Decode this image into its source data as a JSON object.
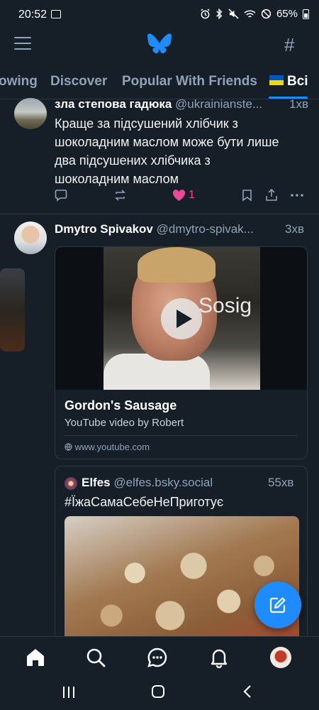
{
  "status_bar": {
    "time": "20:52",
    "battery": "65%"
  },
  "header": {
    "icons": [
      "menu-icon",
      "butterfly-logo",
      "hash-icon"
    ]
  },
  "tabs": [
    {
      "label": "owing"
    },
    {
      "label": "Discover"
    },
    {
      "label": "Popular With Friends"
    },
    {
      "label": "Всі",
      "active": true
    }
  ],
  "posts": [
    {
      "name": "зла степова гадюка",
      "handle": "@ukrainianste...",
      "time": "1хв",
      "text": "Краще за підсушений хлібчик з шоколадним маслом може бути лише два підсушених хлібчика з шоколадним маслом",
      "likes": "1"
    },
    {
      "name": "Dmytro Spivakov",
      "handle": "@dmytro-spivak...",
      "time": "3хв",
      "embed": {
        "thumbnail_text": "Sosig",
        "title": "Gordon's Sausage",
        "description": "YouTube video by Robert",
        "domain": "www.youtube.com"
      }
    }
  ],
  "quote": {
    "name": "Elfes",
    "handle": "@elfes.bsky.social",
    "time": "55хв",
    "text": "#ЇжаСамаСебеНеПриготує"
  },
  "colors": {
    "background": "#161e27",
    "accent": "#208bfe",
    "like": "#ec4899",
    "muted": "#8fa3b8"
  }
}
